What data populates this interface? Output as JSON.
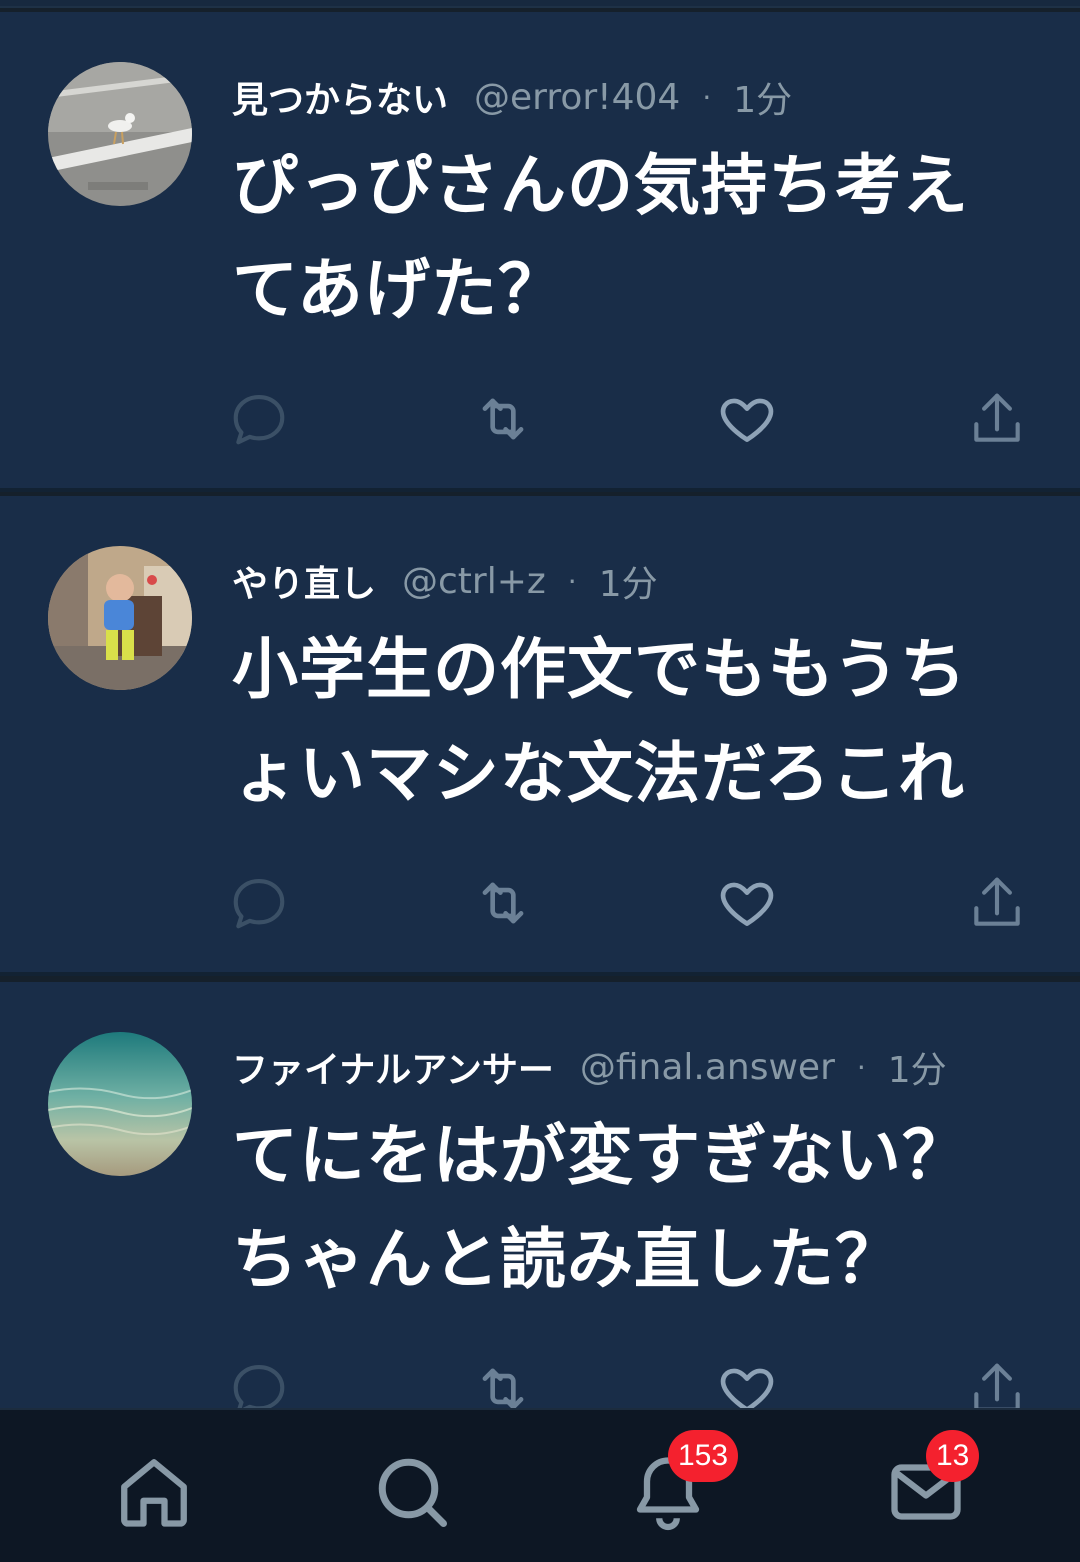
{
  "tweets": [
    {
      "name": "見つからない",
      "handle": "@error!404",
      "separator": "·",
      "time": "1分",
      "text": "ぴっぴさんの気持ち考えてあげた？"
    },
    {
      "name": "やり直し",
      "handle": "@ctrl+z",
      "separator": "·",
      "time": "1分",
      "text": "小学生の作文でももうちょいマシな文法だろこれ"
    },
    {
      "name": "ファイナルアンサー",
      "handle": "@final.answer",
      "separator": "·",
      "time": "1分",
      "text": "てにをはが変すぎない？ちゃんと読み直した？"
    }
  ],
  "actions": [
    "reply-icon",
    "retweet-icon",
    "like-icon",
    "share-icon"
  ],
  "nav": {
    "items": [
      "home-icon",
      "search-icon",
      "notifications-icon",
      "messages-icon"
    ],
    "notifications_badge": "153",
    "messages_badge": "13"
  },
  "colors": {
    "background": "#192d48",
    "secondary_text": "#8899a6",
    "badge": "#f4212e",
    "nav_background": "#0d1724"
  }
}
